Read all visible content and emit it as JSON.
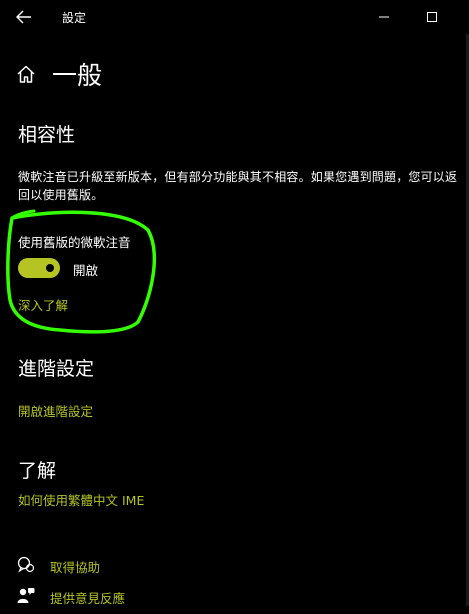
{
  "window": {
    "title": "設定"
  },
  "page": {
    "title": "一般"
  },
  "compat": {
    "heading": "相容性",
    "description": "微軟注音已升級至新版本，但有部分功能與其不相容。如果您遇到問題，您可以返回以使用舊版。",
    "setting_label": "使用舊版的微軟注音",
    "toggle_state": "開啟",
    "toggle_on": true,
    "learn_more": "深入了解"
  },
  "advanced": {
    "heading": "進階設定",
    "link": "開啟進階設定"
  },
  "about": {
    "heading": "了解",
    "link": "如何使用繁體中文 IME"
  },
  "footer": {
    "help": "取得協助",
    "feedback": "提供意見反應"
  },
  "colors": {
    "accent": "#b5c422",
    "background": "#000000",
    "text": "#ffffff",
    "annotation": "#33ff00"
  },
  "icons": {
    "back": "back-arrow-icon",
    "minimize": "minimize-icon",
    "maximize": "maximize-icon",
    "home": "home-icon",
    "help": "help-chat-icon",
    "feedback": "feedback-person-icon"
  }
}
